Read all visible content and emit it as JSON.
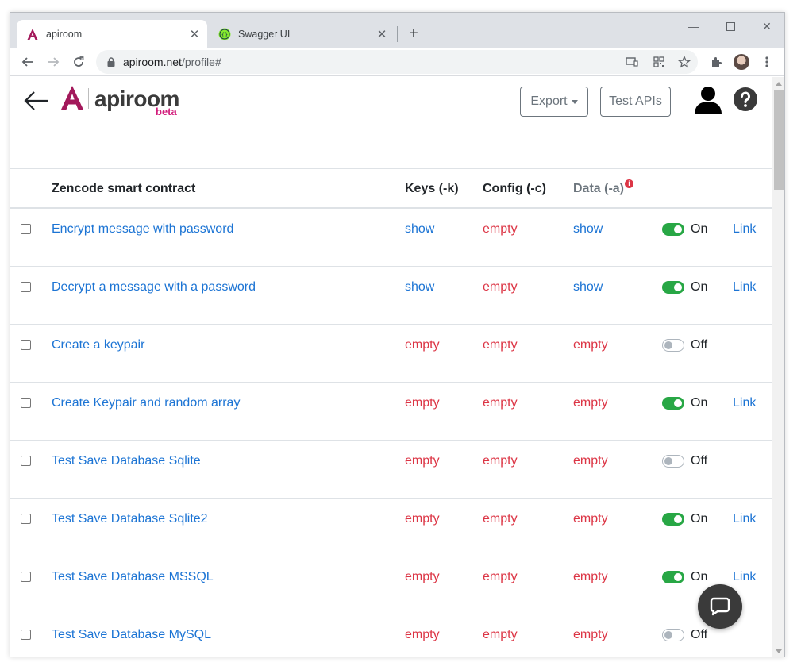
{
  "browser": {
    "tabs": [
      {
        "title": "apiroom",
        "active": true
      },
      {
        "title": "Swagger UI",
        "active": false
      }
    ],
    "url_host": "apiroom.net",
    "url_path": "/profile#"
  },
  "header": {
    "logo_text": "apiroom",
    "logo_badge": "beta",
    "export_label": "Export",
    "test_apis_label": "Test APIs"
  },
  "table": {
    "columns": {
      "name": "Zencode smart contract",
      "keys": "Keys (-k)",
      "config": "Config (-c)",
      "data": "Data (-a)"
    },
    "rows": [
      {
        "name": "Encrypt message with password",
        "keys": "show",
        "config": "empty",
        "data": "show",
        "status": "On",
        "link": "Link"
      },
      {
        "name": "Decrypt a message with a password",
        "keys": "show",
        "config": "empty",
        "data": "show",
        "status": "On",
        "link": "Link"
      },
      {
        "name": "Create a keypair",
        "keys": "empty",
        "config": "empty",
        "data": "empty",
        "status": "Off",
        "link": ""
      },
      {
        "name": "Create Keypair and random array",
        "keys": "empty",
        "config": "empty",
        "data": "empty",
        "status": "On",
        "link": "Link"
      },
      {
        "name": "Test Save Database Sqlite",
        "keys": "empty",
        "config": "empty",
        "data": "empty",
        "status": "Off",
        "link": ""
      },
      {
        "name": "Test Save Database Sqlite2",
        "keys": "empty",
        "config": "empty",
        "data": "empty",
        "status": "On",
        "link": "Link"
      },
      {
        "name": "Test Save Database MSSQL",
        "keys": "empty",
        "config": "empty",
        "data": "empty",
        "status": "On",
        "link": "Link"
      },
      {
        "name": "Test Save Database MySQL",
        "keys": "empty",
        "config": "empty",
        "data": "empty",
        "status": "Off",
        "link": ""
      }
    ]
  },
  "colors": {
    "brand": "#a3195b",
    "link": "#1c74d4",
    "empty": "#dc3545",
    "toggle_on": "#28a745"
  }
}
